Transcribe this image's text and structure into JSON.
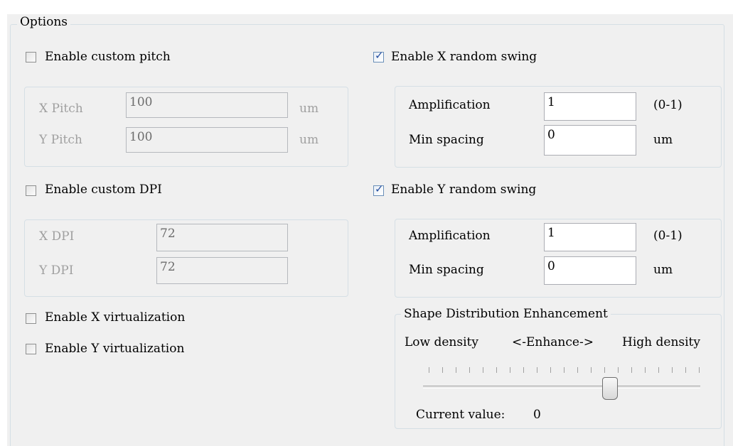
{
  "options": {
    "title": "Options",
    "custom_pitch": {
      "label": "Enable custom pitch",
      "checked": false,
      "x_label": "X Pitch",
      "x_value": "100",
      "x_unit": "um",
      "y_label": "Y Pitch",
      "y_value": "100",
      "y_unit": "um"
    },
    "custom_dpi": {
      "label": "Enable custom DPI",
      "checked": false,
      "x_label": "X DPI",
      "x_value": "72",
      "y_label": "Y DPI",
      "y_value": "72"
    },
    "x_virtualization": {
      "label": "Enable X virtualization",
      "checked": false
    },
    "y_virtualization": {
      "label": "Enable Y virtualization",
      "checked": false
    },
    "x_random_swing": {
      "label": "Enable X random swing",
      "checked": true,
      "amplification_label": "Amplification",
      "amplification_value": "1",
      "amplification_range": "(0-1)",
      "min_spacing_label": "Min spacing",
      "min_spacing_value": "0",
      "min_spacing_unit": "um"
    },
    "y_random_swing": {
      "label": "Enable Y random swing",
      "checked": true,
      "amplification_label": "Amplification",
      "amplification_value": "1",
      "amplification_range": "(0-1)",
      "min_spacing_label": "Min spacing",
      "min_spacing_value": "0",
      "min_spacing_unit": "um"
    },
    "shape_distribution": {
      "title": "Shape Distribution Enhancement",
      "low_label": "Low density",
      "middle_label": "<-Enhance->",
      "high_label": "High density",
      "current_value_label": "Current value:",
      "current_value": "0",
      "slider_position_fraction": 0.675
    },
    "checkmark_symbol": "✓"
  }
}
